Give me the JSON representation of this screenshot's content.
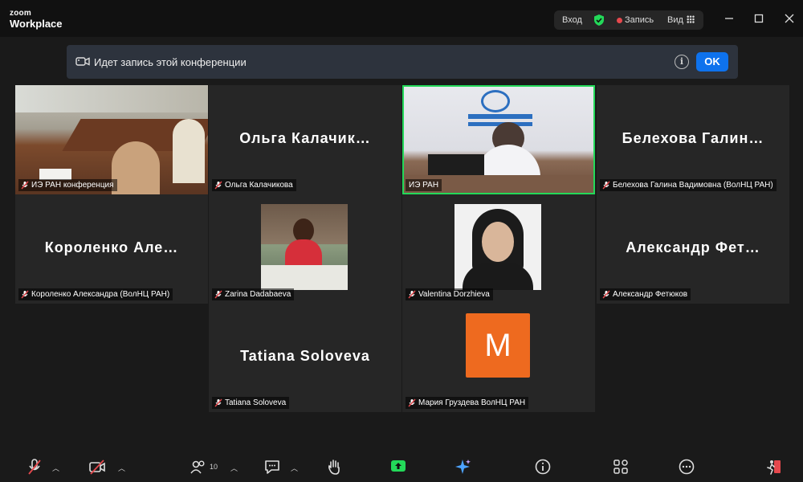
{
  "app": {
    "logo_line1": "zoom",
    "logo_line2": "Workplace"
  },
  "titlebar": {
    "login": "Вход",
    "record": "Запись",
    "view": "Вид"
  },
  "banner": {
    "text": "Идет запись этой конференции",
    "ok": "OK"
  },
  "tiles": [
    {
      "name": "ИЭ РАН конференция",
      "big": ""
    },
    {
      "name": "Ольга Калачикова",
      "big": "Ольга  Калачик…"
    },
    {
      "name": "ИЭ РАН",
      "big": ""
    },
    {
      "name": "Белехова Галина Вадимовна (ВолНЦ РАН)",
      "big": "Белехова  Галин…"
    },
    {
      "name": "Короленко Александра (ВолНЦ РАН)",
      "big": "Короленко  Але…"
    },
    {
      "name": "Zarina Dadabaeva",
      "big": ""
    },
    {
      "name": "Valentina Dorzhieva",
      "big": ""
    },
    {
      "name": "Александр Фетюков",
      "big": "Александр  Фет…"
    },
    {
      "name": "Tatiana Soloveva",
      "big": "Tatiana Soloveva"
    },
    {
      "name": "Мария Груздева ВолНЦ РАН",
      "big": ""
    }
  ],
  "avatar_letter": "M",
  "participants_count": "10",
  "colors": {
    "accent": "#0e72ed",
    "active_speaker": "#23d959",
    "record": "#e5484d",
    "avatar": "#ee6a1f"
  }
}
